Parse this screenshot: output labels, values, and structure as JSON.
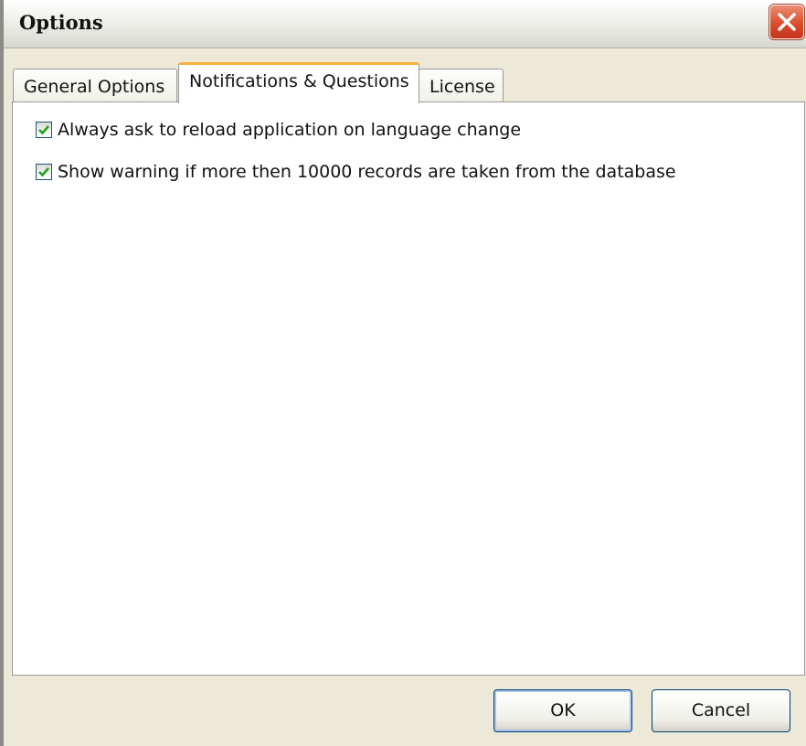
{
  "window": {
    "title": "Options"
  },
  "tabs": [
    {
      "label": "General Options",
      "active": false
    },
    {
      "label": "Notifications & Questions",
      "active": true
    },
    {
      "label": "License",
      "active": false
    }
  ],
  "options": [
    {
      "label": "Always ask to reload application on language change",
      "checked": true
    },
    {
      "label": "Show warning if more then 10000 records are taken from the database",
      "checked": true
    }
  ],
  "buttons": {
    "ok": "OK",
    "cancel": "Cancel"
  },
  "colors": {
    "tab_highlight": "#f7b23a",
    "check_mark": "#21a121",
    "close_button": "#d94d2c"
  },
  "icons": {
    "close": "close-icon",
    "check": "check-icon"
  }
}
